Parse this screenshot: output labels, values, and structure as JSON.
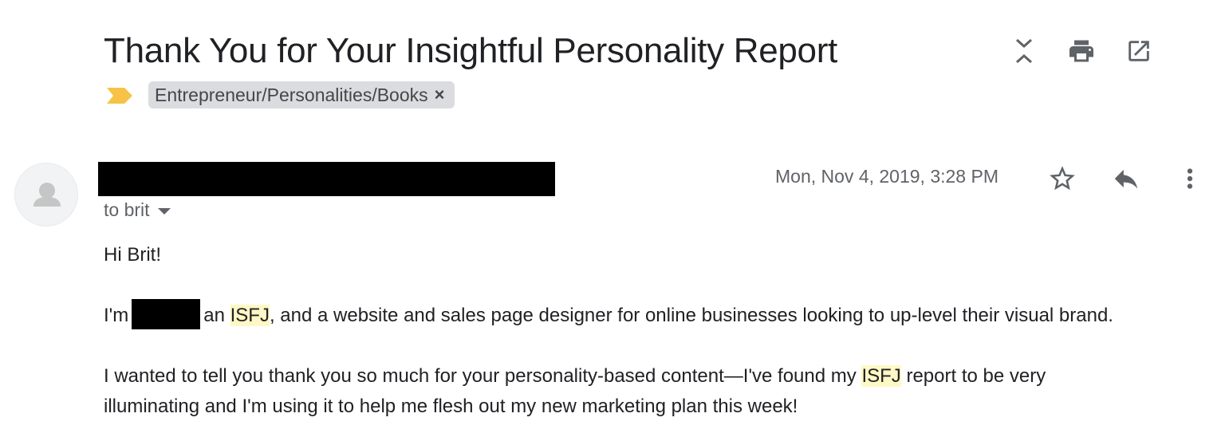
{
  "email": {
    "subject": "Thank You for Your Insightful Personality Report",
    "label": "Entrepreneur/Personalities/Books",
    "label_remove": "×",
    "to": "to brit",
    "date": "Mon, Nov 4, 2019, 3:28 PM"
  },
  "body": {
    "greeting": "Hi Brit!",
    "p1_prefix": "I'm",
    "p1_mid": "an",
    "p1_hl": "ISFJ",
    "p1_suffix": ", and a website and sales page designer for online businesses looking to up-level their visual brand.",
    "p2_prefix": "I wanted to tell you thank you so much for your personality-based content—I've found my",
    "p2_hl": "ISFJ",
    "p2_suffix": "report to be very",
    "p3": "illuminating and I'm using it to help me flesh out my new marketing plan this week!"
  },
  "icons": {
    "expand": "expand-collapse-icon",
    "print": "print-icon",
    "new_window": "open-in-new-window-icon",
    "important": "important-marker-icon",
    "avatar": "default-avatar-icon",
    "star": "star-icon",
    "reply": "reply-icon",
    "more": "more-vert-icon"
  },
  "colors": {
    "important_marker": "#f6c347",
    "highlight": "#fff8c5",
    "label_chip": "#dadce0",
    "redaction": "#000000"
  }
}
